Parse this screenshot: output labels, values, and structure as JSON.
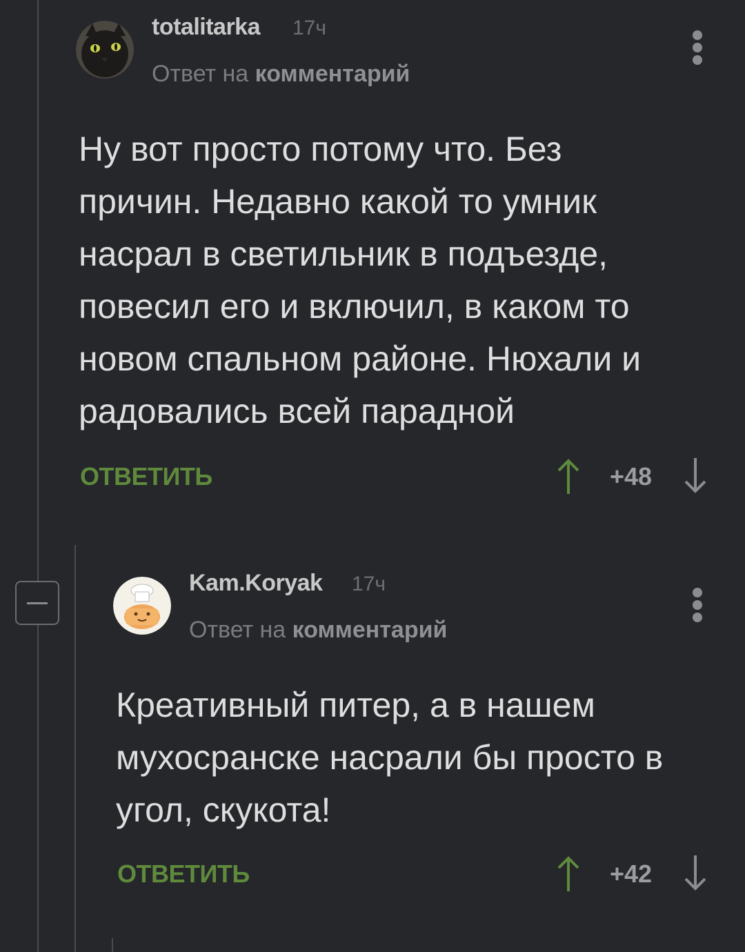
{
  "comments": [
    {
      "author": "totalitarka",
      "time": "17ч",
      "reply_prefix": "Ответ на",
      "reply_target": "комментарий",
      "text": "Ну вот просто потому что. Без\nпричин. Недавно какой то умник\nнасрал в светильник в подъезде,\nповесил его и включил, в каком то\nновом спальном районе. Нюхали и\nрадовались всей парадной",
      "reply_label": "ОТВЕТИТЬ",
      "score": "+48",
      "avatar_icon": "black-cat-avatar"
    },
    {
      "author": "Kam.Koryak",
      "time": "17ч",
      "reply_prefix": "Ответ на",
      "reply_target": "комментарий",
      "text": "Креативный питер, а в нашем\nмухосранске насрали бы просто в\nугол, скукота!",
      "reply_label": "ОТВЕТИТЬ",
      "score": "+42",
      "avatar_icon": "chef-character-avatar"
    }
  ],
  "icons": {
    "upvote": "arrow-up-icon",
    "downvote": "arrow-down-icon",
    "menu": "more-vertical-icon",
    "collapse": "minus-square-icon"
  },
  "colors": {
    "background": "#25272b",
    "reply_green": "#5f8a3c",
    "upvote_green": "#5f8a3c",
    "text": "#dedede",
    "muted": "#7a7c80"
  }
}
